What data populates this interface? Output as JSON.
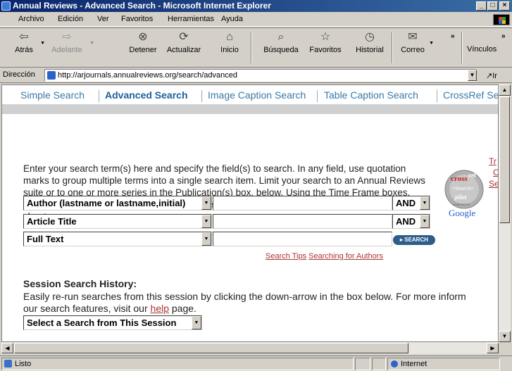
{
  "window": {
    "title": "Annual Reviews - Advanced Search - Microsoft Internet Explorer",
    "min": "_",
    "max": "□",
    "close": "×"
  },
  "menu": [
    "Archivo",
    "Edición",
    "Ver",
    "Favoritos",
    "Herramientas",
    "Ayuda"
  ],
  "toolbar": {
    "back": "Atrás",
    "forward": "Adelante",
    "stop": "Detener",
    "refresh": "Actualizar",
    "home": "Inicio",
    "search": "Búsqueda",
    "favorites": "Favoritos",
    "history": "Historial",
    "mail": "Correo",
    "links": "Vínculos",
    "overflow": "»"
  },
  "address": {
    "label": "Dirección",
    "url": "http://arjournals.annualreviews.org/search/advanced",
    "go": "Ir"
  },
  "tabs": [
    "Simple Search",
    "Advanced Search",
    "Image Caption Search",
    "Table Caption Search",
    "CrossRef Se"
  ],
  "intro": "Enter your search term(s) here and specify the field(s) to search. In any field, use quotation marks to group multiple terms into a single search item. Limit your search to an Annual Reviews suite or to one or more series in the Publication(s) box, below. Using the Time Frame boxes, delimit a range of decades or years. Click the Search button to locate authoritative review chapters.",
  "logo": {
    "line1": "cross",
    "line2": "ref",
    "line3": "<Search>",
    "line4": "pilot",
    "line5": "POWERED BY",
    "line6": "Google"
  },
  "side_links": [
    "Tr",
    "C",
    "Se"
  ],
  "fields": [
    {
      "field": "Author (lastname or lastname,initial)",
      "op": "AND"
    },
    {
      "field": "Article Title",
      "op": "AND"
    },
    {
      "field": "Full Text",
      "op": ""
    }
  ],
  "search_button": "SEARCH",
  "tips": {
    "search_tips": "Search Tips",
    "searching_authors": "Searching for Authors"
  },
  "history": {
    "heading": "Session Search History:",
    "line1": "Easily re-run searches from this session by clicking the down-arrow in the box below. For more inform",
    "line2_pre": "our search features, visit our ",
    "line2_link": "help",
    "line2_post": " page.",
    "select": "Select a Search from This Session"
  },
  "status": {
    "text": "Listo",
    "zone": "Internet"
  }
}
